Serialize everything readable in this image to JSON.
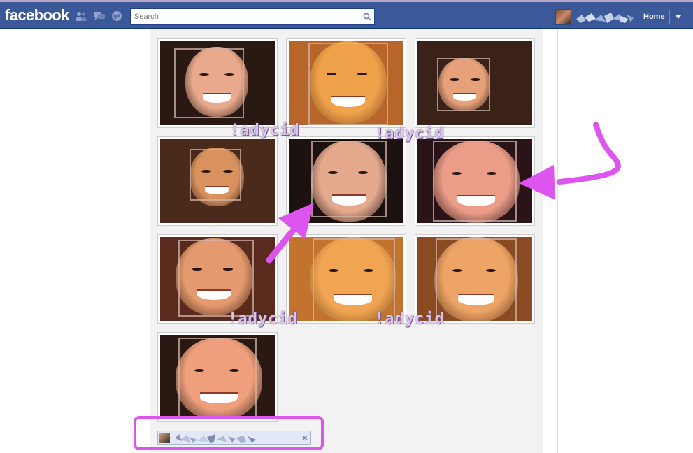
{
  "topbar": {
    "logo": "facebook",
    "search_placeholder": "Search",
    "home_label": "Home",
    "jewels": [
      "friend-requests-icon",
      "messages-icon",
      "notifications-icon"
    ]
  },
  "watermark_text": "!adycid",
  "photos": [
    {
      "face": "#e8a98c",
      "bg": "#2a1812"
    },
    {
      "face": "#f0a24a",
      "bg": "#b7652a"
    },
    {
      "face": "#e6a07a",
      "bg": "#3a2218"
    },
    {
      "face": "#d9925e",
      "bg": "#4a2a1a"
    },
    {
      "face": "#e5a98e",
      "bg": "#1b1210"
    },
    {
      "face": "#eb9d88",
      "bg": "#2a1418"
    },
    {
      "face": "#e49a6e",
      "bg": "#5a2a1c"
    },
    {
      "face": "#f1a552",
      "bg": "#c2742e"
    },
    {
      "face": "#eda466",
      "bg": "#8a4a22"
    },
    {
      "face": "#ef9f7c",
      "bg": "#2a1812"
    }
  ],
  "annotation_color": "#dd55ee",
  "tagbar": {
    "close_label": "×"
  }
}
